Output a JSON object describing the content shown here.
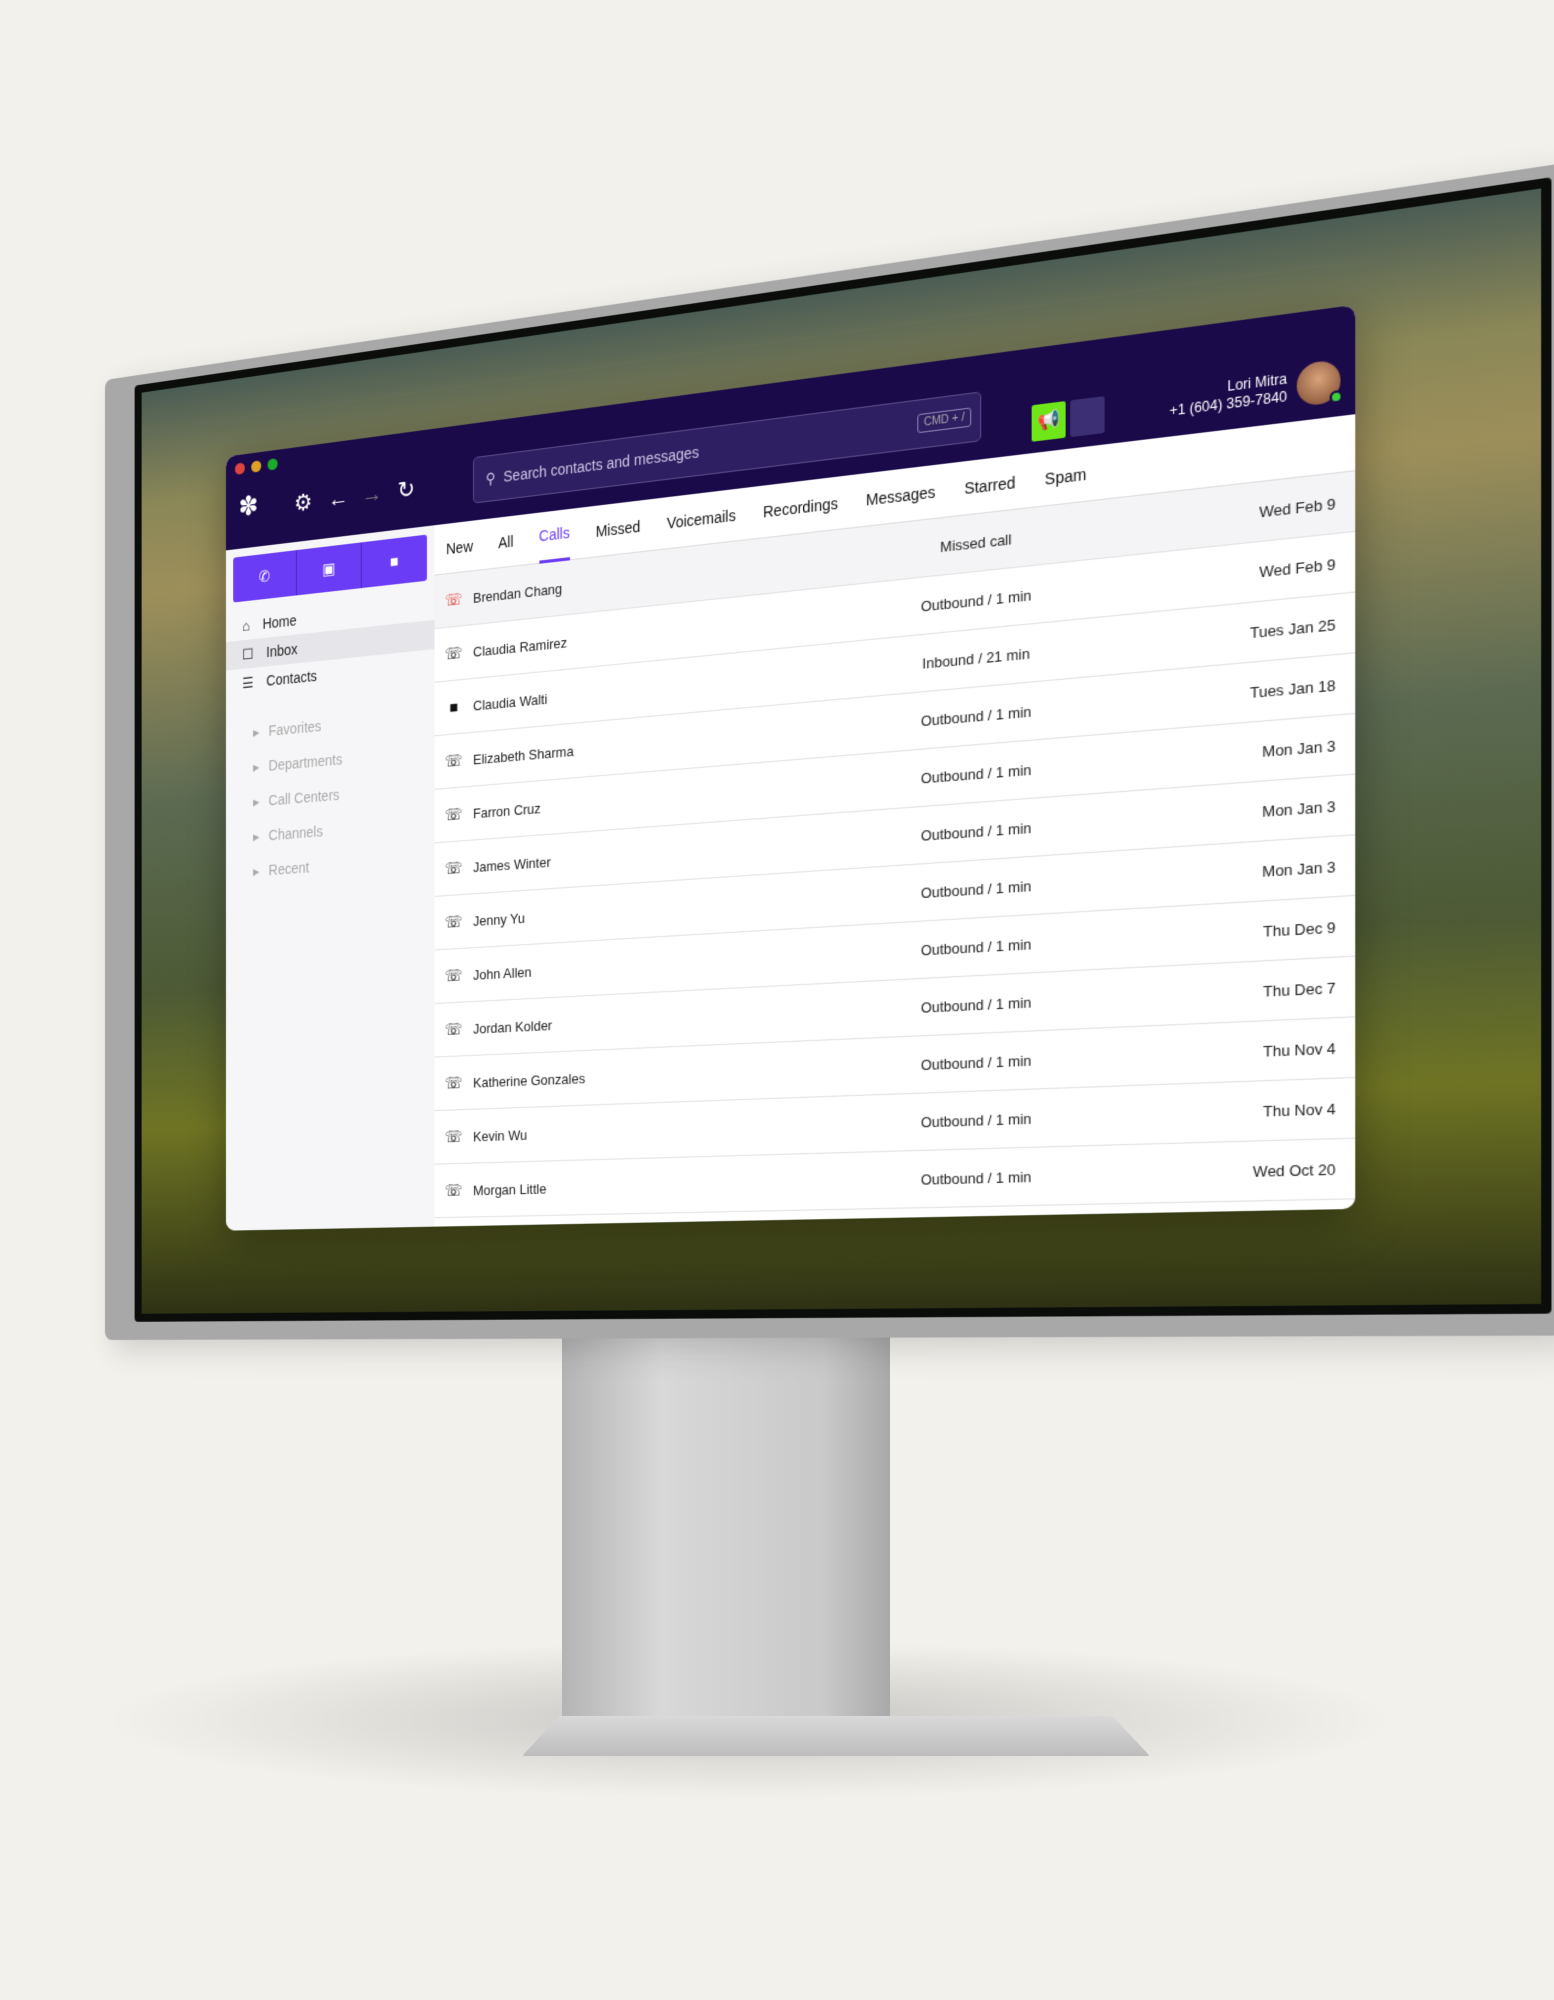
{
  "window_controls": {
    "close": "#e0443e",
    "minimize": "#dea123",
    "maximize": "#1aab29"
  },
  "toolbar": {
    "search_placeholder": "Search contacts and messages",
    "shortcut": "CMD + /",
    "logo": "app-logo",
    "icons": [
      "gear-icon",
      "arrow-left-icon",
      "arrow-right-icon",
      "refresh-icon"
    ]
  },
  "user": {
    "name": "Lori Mitra",
    "phone": "+1 (604) 359-7840",
    "status": "online"
  },
  "colors": {
    "titlebar": "#1b0a4a",
    "accent": "#6b3cf5",
    "broadcast": "#6ee617",
    "missed": "#e02b2b"
  },
  "sidebar": {
    "actions": [
      "phone-icon",
      "message-icon",
      "video-icon"
    ],
    "nav": [
      {
        "label": "Home",
        "icon": "home-icon"
      },
      {
        "label": "Inbox",
        "icon": "inbox-icon",
        "active": true
      },
      {
        "label": "Contacts",
        "icon": "contacts-icon"
      }
    ],
    "groups": [
      "Favorites",
      "Departments",
      "Call Centers",
      "Channels",
      "Recent"
    ]
  },
  "tabs": [
    {
      "label": "New"
    },
    {
      "label": "All"
    },
    {
      "label": "Calls",
      "active": true
    },
    {
      "label": "Missed"
    },
    {
      "label": "Voicemails"
    },
    {
      "label": "Recordings"
    },
    {
      "label": "Messages"
    },
    {
      "label": "Starred"
    },
    {
      "label": "Spam"
    }
  ],
  "calls": [
    {
      "name": "Brendan Chang",
      "type": "missed",
      "detail": "Missed call",
      "date": "Wed Feb 9"
    },
    {
      "name": "Claudia Ramirez",
      "type": "outbound",
      "detail": "Outbound / 1 min",
      "date": "Wed Feb 9"
    },
    {
      "name": "Claudia Walti",
      "type": "video",
      "detail": "Inbound / 21 min",
      "date": "Tues Jan 25"
    },
    {
      "name": "Elizabeth Sharma",
      "type": "outbound",
      "detail": "Outbound / 1 min",
      "date": "Tues Jan 18"
    },
    {
      "name": "Farron Cruz",
      "type": "outbound",
      "detail": "Outbound / 1 min",
      "date": "Mon Jan 3"
    },
    {
      "name": "James Winter",
      "type": "outbound",
      "detail": "Outbound / 1 min",
      "date": "Mon Jan 3"
    },
    {
      "name": "Jenny Yu",
      "type": "outbound",
      "detail": "Outbound / 1 min",
      "date": "Mon Jan 3"
    },
    {
      "name": "John Allen",
      "type": "outbound",
      "detail": "Outbound / 1 min",
      "date": "Thu Dec 9"
    },
    {
      "name": "Jordan Kolder",
      "type": "outbound",
      "detail": "Outbound / 1 min",
      "date": "Thu Dec 7"
    },
    {
      "name": "Katherine Gonzales",
      "type": "outbound",
      "detail": "Outbound / 1 min",
      "date": "Thu Nov 4"
    },
    {
      "name": "Kevin Wu",
      "type": "outbound",
      "detail": "Outbound / 1 min",
      "date": "Thu Nov 4"
    },
    {
      "name": "Morgan Little",
      "type": "outbound",
      "detail": "Outbound / 1 min",
      "date": "Wed Oct 20"
    }
  ]
}
